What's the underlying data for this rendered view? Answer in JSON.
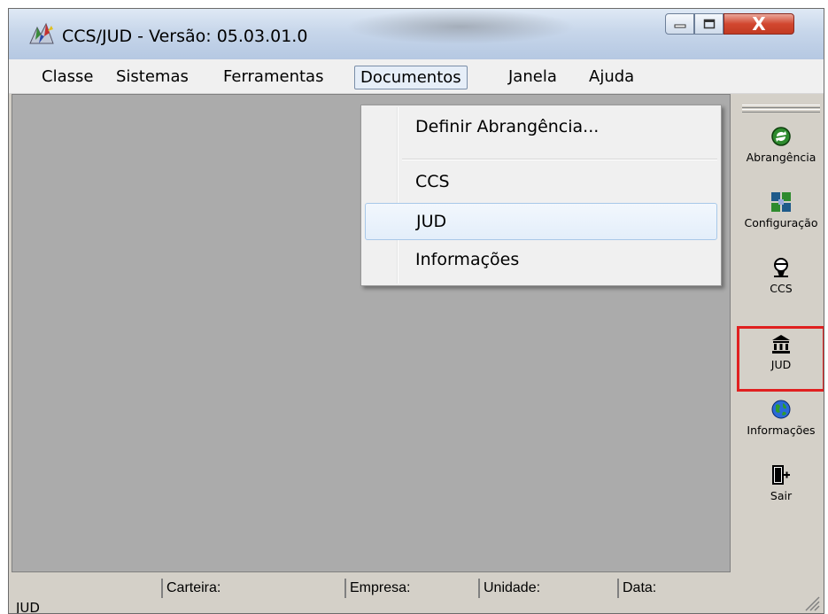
{
  "window": {
    "title": "CCS/JUD - Versão: 05.03.01.0",
    "close_glyph": "X"
  },
  "menubar": {
    "items": [
      {
        "label": "Classe"
      },
      {
        "label": "Sistemas"
      },
      {
        "label": "Ferramentas"
      },
      {
        "label": "Documentos"
      },
      {
        "label": "Janela"
      },
      {
        "label": "Ajuda"
      }
    ]
  },
  "dropdown": {
    "items": [
      {
        "label": "Definir Abrangência..."
      },
      {
        "label": "CCS"
      },
      {
        "label": "JUD"
      },
      {
        "label": "Informações"
      }
    ]
  },
  "toolbar": {
    "buttons": [
      {
        "label": "Abrangência",
        "icon": "refresh-icon"
      },
      {
        "label": "Configuração",
        "icon": "config-icon"
      },
      {
        "label": "CCS",
        "icon": "ccs-icon"
      },
      {
        "label": "JUD",
        "icon": "bank-icon"
      },
      {
        "label": "Informações",
        "icon": "globe-icon"
      },
      {
        "label": "Sair",
        "icon": "exit-door-icon"
      }
    ]
  },
  "statusbar": {
    "left_text": "JUD",
    "fields": [
      {
        "label": "Carteira:"
      },
      {
        "label": "Empresa:"
      },
      {
        "label": "Unidade:"
      },
      {
        "label": "Data:"
      }
    ]
  },
  "colors": {
    "highlight_border": "#e02020",
    "mdi_background": "#ababab"
  }
}
